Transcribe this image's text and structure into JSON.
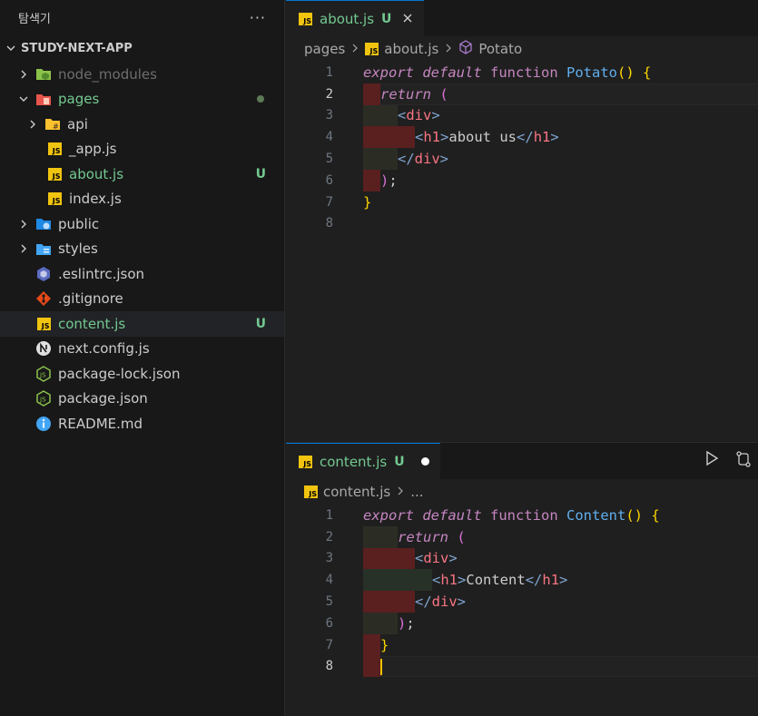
{
  "sidebar": {
    "title": "탐색기",
    "more_label": "···",
    "root_label": "STUDY-NEXT-APP",
    "items": [
      {
        "label": "node_modules",
        "badge": ""
      },
      {
        "label": "pages",
        "badge": ""
      },
      {
        "label": "api",
        "badge": ""
      },
      {
        "label": "_app.js",
        "badge": ""
      },
      {
        "label": "about.js",
        "badge": "U"
      },
      {
        "label": "index.js",
        "badge": ""
      },
      {
        "label": "public",
        "badge": ""
      },
      {
        "label": "styles",
        "badge": ""
      },
      {
        "label": ".eslintrc.json",
        "badge": ""
      },
      {
        "label": ".gitignore",
        "badge": ""
      },
      {
        "label": "content.js",
        "badge": "U"
      },
      {
        "label": "next.config.js",
        "badge": ""
      },
      {
        "label": "package-lock.json",
        "badge": ""
      },
      {
        "label": "package.json",
        "badge": ""
      },
      {
        "label": "README.md",
        "badge": ""
      }
    ]
  },
  "editor_top": {
    "tab_label": "about.js",
    "tab_status": "U",
    "breadcrumb": [
      "pages",
      "about.js",
      "Potato"
    ],
    "line_numbers": [
      "1",
      "2",
      "3",
      "4",
      "5",
      "6",
      "7",
      "8"
    ],
    "code": {
      "l1_export": "export",
      "l1_default": "default",
      "l1_function": "function",
      "l1_name": "Potato",
      "l1_parens": "()",
      "l1_brace": "{",
      "l2_return": "return",
      "l2_paren": "(",
      "l3_open": "<",
      "l3_tag": "div",
      "l3_close": ">",
      "l4_open": "<",
      "l4_tag": "h1",
      "l4_close": ">",
      "l4_text": "about us",
      "l4_end_open": "</",
      "l4_end_tag": "h1",
      "l4_end_close": ">",
      "l5_open": "</",
      "l5_tag": "div",
      "l5_close": ">",
      "l6_paren": ")",
      "l6_semi": ";",
      "l7_brace": "}"
    }
  },
  "editor_bottom": {
    "tab_label": "content.js",
    "tab_status": "U",
    "breadcrumb": [
      "content.js",
      "..."
    ],
    "line_numbers": [
      "1",
      "2",
      "3",
      "4",
      "5",
      "6",
      "7",
      "8"
    ],
    "code": {
      "l1_export": "export",
      "l1_default": "default",
      "l1_function": "function",
      "l1_name": "Content",
      "l1_parens": "()",
      "l1_brace": "{",
      "l2_return": "return",
      "l2_paren": "(",
      "l3_open": "<",
      "l3_tag": "div",
      "l3_close": ">",
      "l4_open": "<",
      "l4_tag": "h1",
      "l4_close": ">",
      "l4_text": "Content",
      "l4_end_open": "</",
      "l4_end_tag": "h1",
      "l4_end_close": ">",
      "l5_open": "</",
      "l5_tag": "div",
      "l5_close": ">",
      "l6_paren": ")",
      "l6_semi": ";",
      "l7_brace": "}"
    }
  },
  "colors": {
    "git_untracked": "#73c991",
    "accent": "#0078d4",
    "keyword": "#c586c0",
    "function_name": "#61afef",
    "bracket": "#ffd700",
    "tag": "#f97583"
  }
}
